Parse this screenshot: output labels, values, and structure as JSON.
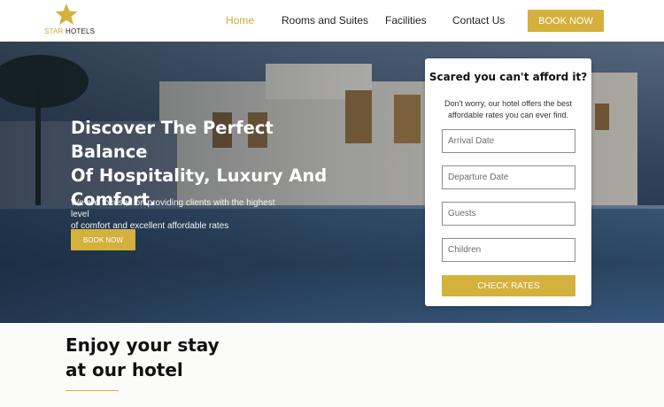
{
  "brand": {
    "logo_text_1": "STAR",
    "logo_text_2": " HOTELS",
    "accent_color": "#d4b03c"
  },
  "nav": {
    "items": [
      {
        "label": "Home",
        "active": true
      },
      {
        "label": "Rooms and Suites",
        "active": false
      },
      {
        "label": "Facilities",
        "active": false
      },
      {
        "label": "Contact Us",
        "active": false
      }
    ],
    "cta_label": "BOOK NOW"
  },
  "hero": {
    "title_lines": [
      "Discover The Perfect Balance",
      "Of Hospitality, Luxury And",
      "Comfort."
    ],
    "subtitle_lines": [
      "We are focused on providing clients with the highest level",
      "of comfort and excellent affordable rates"
    ],
    "button_label": "BOOK NOW"
  },
  "booking": {
    "title": "Scared you can't afford it?",
    "description_lines": [
      "Don't worry, our hotel offers the best",
      "affordable rates you can ever find."
    ],
    "fields": [
      {
        "placeholder": "Arrival Date",
        "value": ""
      },
      {
        "placeholder": "Departure Date",
        "value": ""
      },
      {
        "placeholder": "Guests",
        "value": ""
      },
      {
        "placeholder": "Children",
        "value": ""
      }
    ],
    "submit_label": "CHECK RATES"
  },
  "intro": {
    "title_lines": [
      "Enjoy your stay",
      "at our hotel"
    ]
  },
  "icons": {
    "logo": "star-icon"
  }
}
